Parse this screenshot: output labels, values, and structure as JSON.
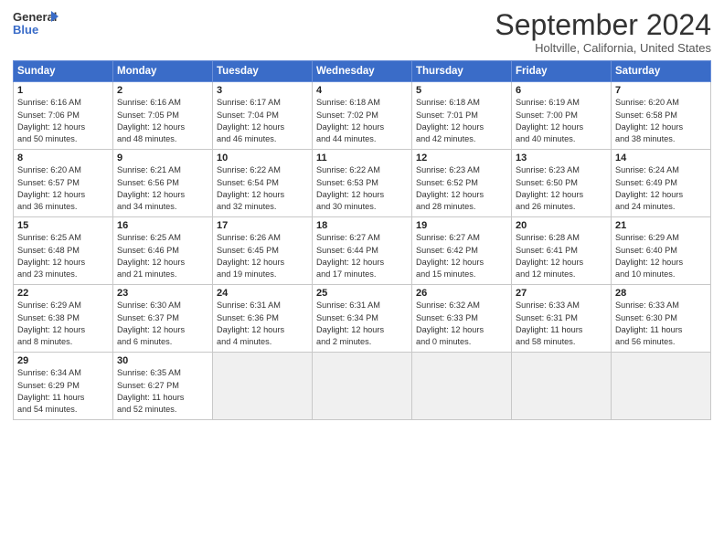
{
  "header": {
    "logo_line1": "General",
    "logo_line2": "Blue",
    "title": "September 2024",
    "location": "Holtville, California, United States"
  },
  "days_of_week": [
    "Sunday",
    "Monday",
    "Tuesday",
    "Wednesday",
    "Thursday",
    "Friday",
    "Saturday"
  ],
  "weeks": [
    [
      {
        "day": "1",
        "lines": [
          "Sunrise: 6:16 AM",
          "Sunset: 7:06 PM",
          "Daylight: 12 hours",
          "and 50 minutes."
        ]
      },
      {
        "day": "2",
        "lines": [
          "Sunrise: 6:16 AM",
          "Sunset: 7:05 PM",
          "Daylight: 12 hours",
          "and 48 minutes."
        ]
      },
      {
        "day": "3",
        "lines": [
          "Sunrise: 6:17 AM",
          "Sunset: 7:04 PM",
          "Daylight: 12 hours",
          "and 46 minutes."
        ]
      },
      {
        "day": "4",
        "lines": [
          "Sunrise: 6:18 AM",
          "Sunset: 7:02 PM",
          "Daylight: 12 hours",
          "and 44 minutes."
        ]
      },
      {
        "day": "5",
        "lines": [
          "Sunrise: 6:18 AM",
          "Sunset: 7:01 PM",
          "Daylight: 12 hours",
          "and 42 minutes."
        ]
      },
      {
        "day": "6",
        "lines": [
          "Sunrise: 6:19 AM",
          "Sunset: 7:00 PM",
          "Daylight: 12 hours",
          "and 40 minutes."
        ]
      },
      {
        "day": "7",
        "lines": [
          "Sunrise: 6:20 AM",
          "Sunset: 6:58 PM",
          "Daylight: 12 hours",
          "and 38 minutes."
        ]
      }
    ],
    [
      {
        "day": "8",
        "lines": [
          "Sunrise: 6:20 AM",
          "Sunset: 6:57 PM",
          "Daylight: 12 hours",
          "and 36 minutes."
        ]
      },
      {
        "day": "9",
        "lines": [
          "Sunrise: 6:21 AM",
          "Sunset: 6:56 PM",
          "Daylight: 12 hours",
          "and 34 minutes."
        ]
      },
      {
        "day": "10",
        "lines": [
          "Sunrise: 6:22 AM",
          "Sunset: 6:54 PM",
          "Daylight: 12 hours",
          "and 32 minutes."
        ]
      },
      {
        "day": "11",
        "lines": [
          "Sunrise: 6:22 AM",
          "Sunset: 6:53 PM",
          "Daylight: 12 hours",
          "and 30 minutes."
        ]
      },
      {
        "day": "12",
        "lines": [
          "Sunrise: 6:23 AM",
          "Sunset: 6:52 PM",
          "Daylight: 12 hours",
          "and 28 minutes."
        ]
      },
      {
        "day": "13",
        "lines": [
          "Sunrise: 6:23 AM",
          "Sunset: 6:50 PM",
          "Daylight: 12 hours",
          "and 26 minutes."
        ]
      },
      {
        "day": "14",
        "lines": [
          "Sunrise: 6:24 AM",
          "Sunset: 6:49 PM",
          "Daylight: 12 hours",
          "and 24 minutes."
        ]
      }
    ],
    [
      {
        "day": "15",
        "lines": [
          "Sunrise: 6:25 AM",
          "Sunset: 6:48 PM",
          "Daylight: 12 hours",
          "and 23 minutes."
        ]
      },
      {
        "day": "16",
        "lines": [
          "Sunrise: 6:25 AM",
          "Sunset: 6:46 PM",
          "Daylight: 12 hours",
          "and 21 minutes."
        ]
      },
      {
        "day": "17",
        "lines": [
          "Sunrise: 6:26 AM",
          "Sunset: 6:45 PM",
          "Daylight: 12 hours",
          "and 19 minutes."
        ]
      },
      {
        "day": "18",
        "lines": [
          "Sunrise: 6:27 AM",
          "Sunset: 6:44 PM",
          "Daylight: 12 hours",
          "and 17 minutes."
        ]
      },
      {
        "day": "19",
        "lines": [
          "Sunrise: 6:27 AM",
          "Sunset: 6:42 PM",
          "Daylight: 12 hours",
          "and 15 minutes."
        ]
      },
      {
        "day": "20",
        "lines": [
          "Sunrise: 6:28 AM",
          "Sunset: 6:41 PM",
          "Daylight: 12 hours",
          "and 12 minutes."
        ]
      },
      {
        "day": "21",
        "lines": [
          "Sunrise: 6:29 AM",
          "Sunset: 6:40 PM",
          "Daylight: 12 hours",
          "and 10 minutes."
        ]
      }
    ],
    [
      {
        "day": "22",
        "lines": [
          "Sunrise: 6:29 AM",
          "Sunset: 6:38 PM",
          "Daylight: 12 hours",
          "and 8 minutes."
        ]
      },
      {
        "day": "23",
        "lines": [
          "Sunrise: 6:30 AM",
          "Sunset: 6:37 PM",
          "Daylight: 12 hours",
          "and 6 minutes."
        ]
      },
      {
        "day": "24",
        "lines": [
          "Sunrise: 6:31 AM",
          "Sunset: 6:36 PM",
          "Daylight: 12 hours",
          "and 4 minutes."
        ]
      },
      {
        "day": "25",
        "lines": [
          "Sunrise: 6:31 AM",
          "Sunset: 6:34 PM",
          "Daylight: 12 hours",
          "and 2 minutes."
        ]
      },
      {
        "day": "26",
        "lines": [
          "Sunrise: 6:32 AM",
          "Sunset: 6:33 PM",
          "Daylight: 12 hours",
          "and 0 minutes."
        ]
      },
      {
        "day": "27",
        "lines": [
          "Sunrise: 6:33 AM",
          "Sunset: 6:31 PM",
          "Daylight: 11 hours",
          "and 58 minutes."
        ]
      },
      {
        "day": "28",
        "lines": [
          "Sunrise: 6:33 AM",
          "Sunset: 6:30 PM",
          "Daylight: 11 hours",
          "and 56 minutes."
        ]
      }
    ],
    [
      {
        "day": "29",
        "lines": [
          "Sunrise: 6:34 AM",
          "Sunset: 6:29 PM",
          "Daylight: 11 hours",
          "and 54 minutes."
        ]
      },
      {
        "day": "30",
        "lines": [
          "Sunrise: 6:35 AM",
          "Sunset: 6:27 PM",
          "Daylight: 11 hours",
          "and 52 minutes."
        ]
      },
      {
        "day": "",
        "lines": []
      },
      {
        "day": "",
        "lines": []
      },
      {
        "day": "",
        "lines": []
      },
      {
        "day": "",
        "lines": []
      },
      {
        "day": "",
        "lines": []
      }
    ]
  ]
}
